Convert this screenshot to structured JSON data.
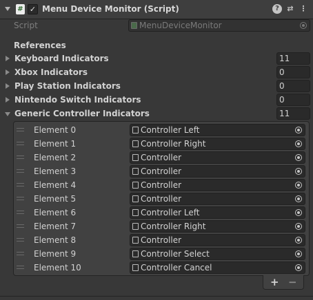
{
  "component": {
    "title": "Menu Device Monitor (Script)",
    "enabled": "✓",
    "script_icon": "#",
    "header_icons": [
      "help-icon",
      "presets-icon",
      "kebab-menu-icon"
    ],
    "help_glyph": "?",
    "presets_glyph": "⇄",
    "kebab_glyph": "⋮"
  },
  "script_row": {
    "label": "Script",
    "value": "MenuDeviceMonitor"
  },
  "references_label": "References",
  "arrays": [
    {
      "label": "Keyboard Indicators",
      "count": "11",
      "expanded": false
    },
    {
      "label": "Xbox Indicators",
      "count": "0",
      "expanded": false
    },
    {
      "label": "Play Station Indicators",
      "count": "0",
      "expanded": false
    },
    {
      "label": "Nintendo Switch Indicators",
      "count": "0",
      "expanded": false
    },
    {
      "label": "Generic Controller Indicators",
      "count": "11",
      "expanded": true
    }
  ],
  "elements": [
    {
      "label": "Element 0",
      "value": "Controller Left"
    },
    {
      "label": "Element 1",
      "value": "Controller Right"
    },
    {
      "label": "Element 2",
      "value": "Controller"
    },
    {
      "label": "Element 3",
      "value": "Controller"
    },
    {
      "label": "Element 4",
      "value": "Controller"
    },
    {
      "label": "Element 5",
      "value": "Controller"
    },
    {
      "label": "Element 6",
      "value": "Controller Left"
    },
    {
      "label": "Element 7",
      "value": "Controller Right"
    },
    {
      "label": "Element 8",
      "value": "Controller"
    },
    {
      "label": "Element 9",
      "value": "Controller Select"
    },
    {
      "label": "Element 10",
      "value": "Controller Cancel"
    }
  ],
  "list_footer": {
    "add": "+",
    "remove": "−"
  },
  "colors": {
    "background": "#383838",
    "field": "#2a2a2a",
    "list_bg": "#414141",
    "text": "#d2d2d2",
    "dim_text": "#7e7e7e"
  }
}
